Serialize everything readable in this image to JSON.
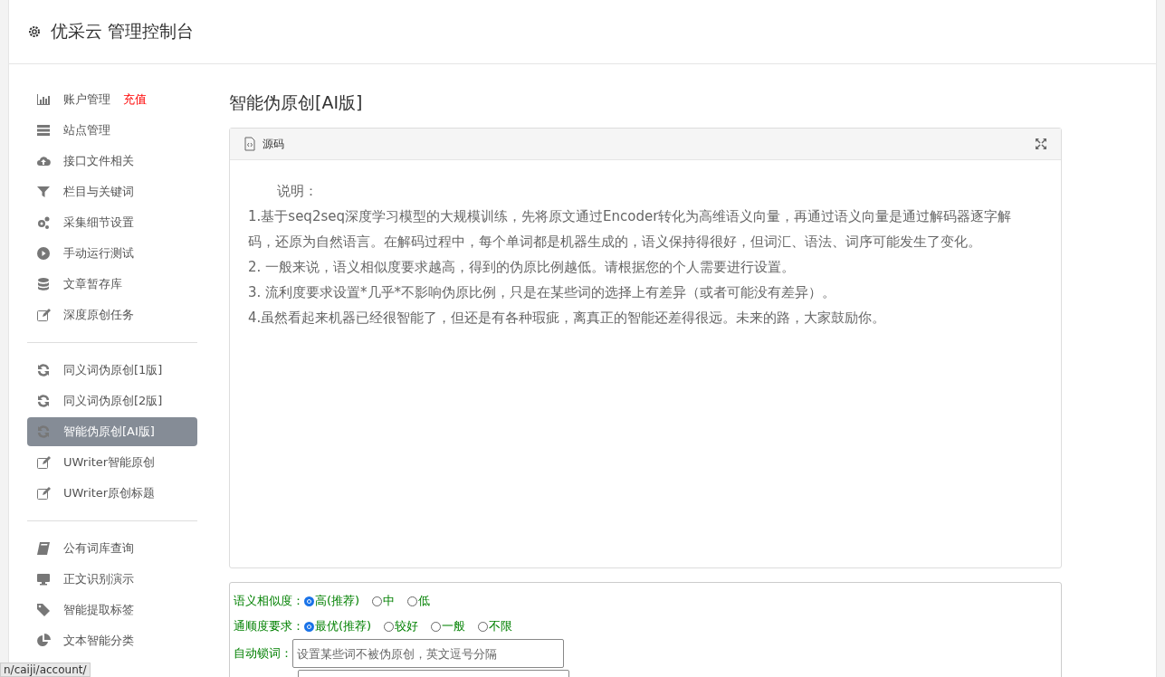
{
  "header": {
    "title": "优采云 管理控制台"
  },
  "sidebar": {
    "groups": [
      {
        "items": [
          {
            "label": "账户管理",
            "badge": "充值",
            "selected": false
          },
          {
            "label": "站点管理",
            "selected": false
          },
          {
            "label": "接口文件相关",
            "selected": false
          },
          {
            "label": "栏目与关键词",
            "selected": false
          },
          {
            "label": "采集细节设置",
            "selected": false
          },
          {
            "label": "手动运行测试",
            "selected": false
          },
          {
            "label": "文章暂存库",
            "selected": false
          },
          {
            "label": "深度原创任务",
            "selected": false
          }
        ]
      },
      {
        "items": [
          {
            "label": "同义词伪原创[1版]",
            "selected": false
          },
          {
            "label": "同义词伪原创[2版]",
            "selected": false
          },
          {
            "label": "智能伪原创[AI版]",
            "selected": true
          },
          {
            "label": "UWriter智能原创",
            "selected": false
          },
          {
            "label": "UWriter原创标题",
            "selected": false
          }
        ]
      },
      {
        "items": [
          {
            "label": "公有词库查询",
            "selected": false
          },
          {
            "label": "正文识别演示",
            "selected": false
          },
          {
            "label": "智能提取标签",
            "selected": false
          },
          {
            "label": "文本智能分类",
            "selected": false
          }
        ]
      }
    ]
  },
  "main": {
    "title": "智能伪原创[AI版]",
    "panel": {
      "title": "源码",
      "heading": "说明：",
      "lines": [
        "1.基于seq2seq深度学习模型的大规模训练，先将原文通过Encoder转化为高维语义向量，再通过语义向量是通过解码器逐字解码，还原为自然语言。在解码过程中，每个单词都是机器生成的，语义保持得很好，但词汇、语法、词序可能发生了变化。",
        "2. 一般来说，语义相似度要求越高，得到的伪原比例越低。请根据您的个人需要进行设置。",
        "3. 流利度要求设置*几乎*不影响伪原比例，只是在某些词的选择上有差异（或者可能没有差异）。",
        "4.虽然看起来机器已经很智能了，但还是有各种瑕疵，离真正的智能还差得很远。未来的路，大家鼓励你。"
      ]
    },
    "form": {
      "rows": [
        {
          "kind": "radio",
          "label": "语义相似度：",
          "options": [
            {
              "label": "高(推荐)",
              "selected": true
            },
            {
              "label": "中",
              "selected": false
            },
            {
              "label": "低",
              "selected": false
            }
          ]
        },
        {
          "kind": "radio",
          "label": "通顺度要求：",
          "options": [
            {
              "label": "最优(推荐)",
              "selected": true
            },
            {
              "label": "较好",
              "selected": false
            },
            {
              "label": "一般",
              "selected": false
            },
            {
              "label": "不限",
              "selected": false
            }
          ]
        },
        {
          "kind": "input",
          "label": "自动锁词：",
          "placeholder": "设置某些词不被伪原创，英文逗号分隔"
        },
        {
          "kind": "input2"
        }
      ]
    }
  },
  "status_bar": {
    "url": "n/caiji/account/"
  }
}
